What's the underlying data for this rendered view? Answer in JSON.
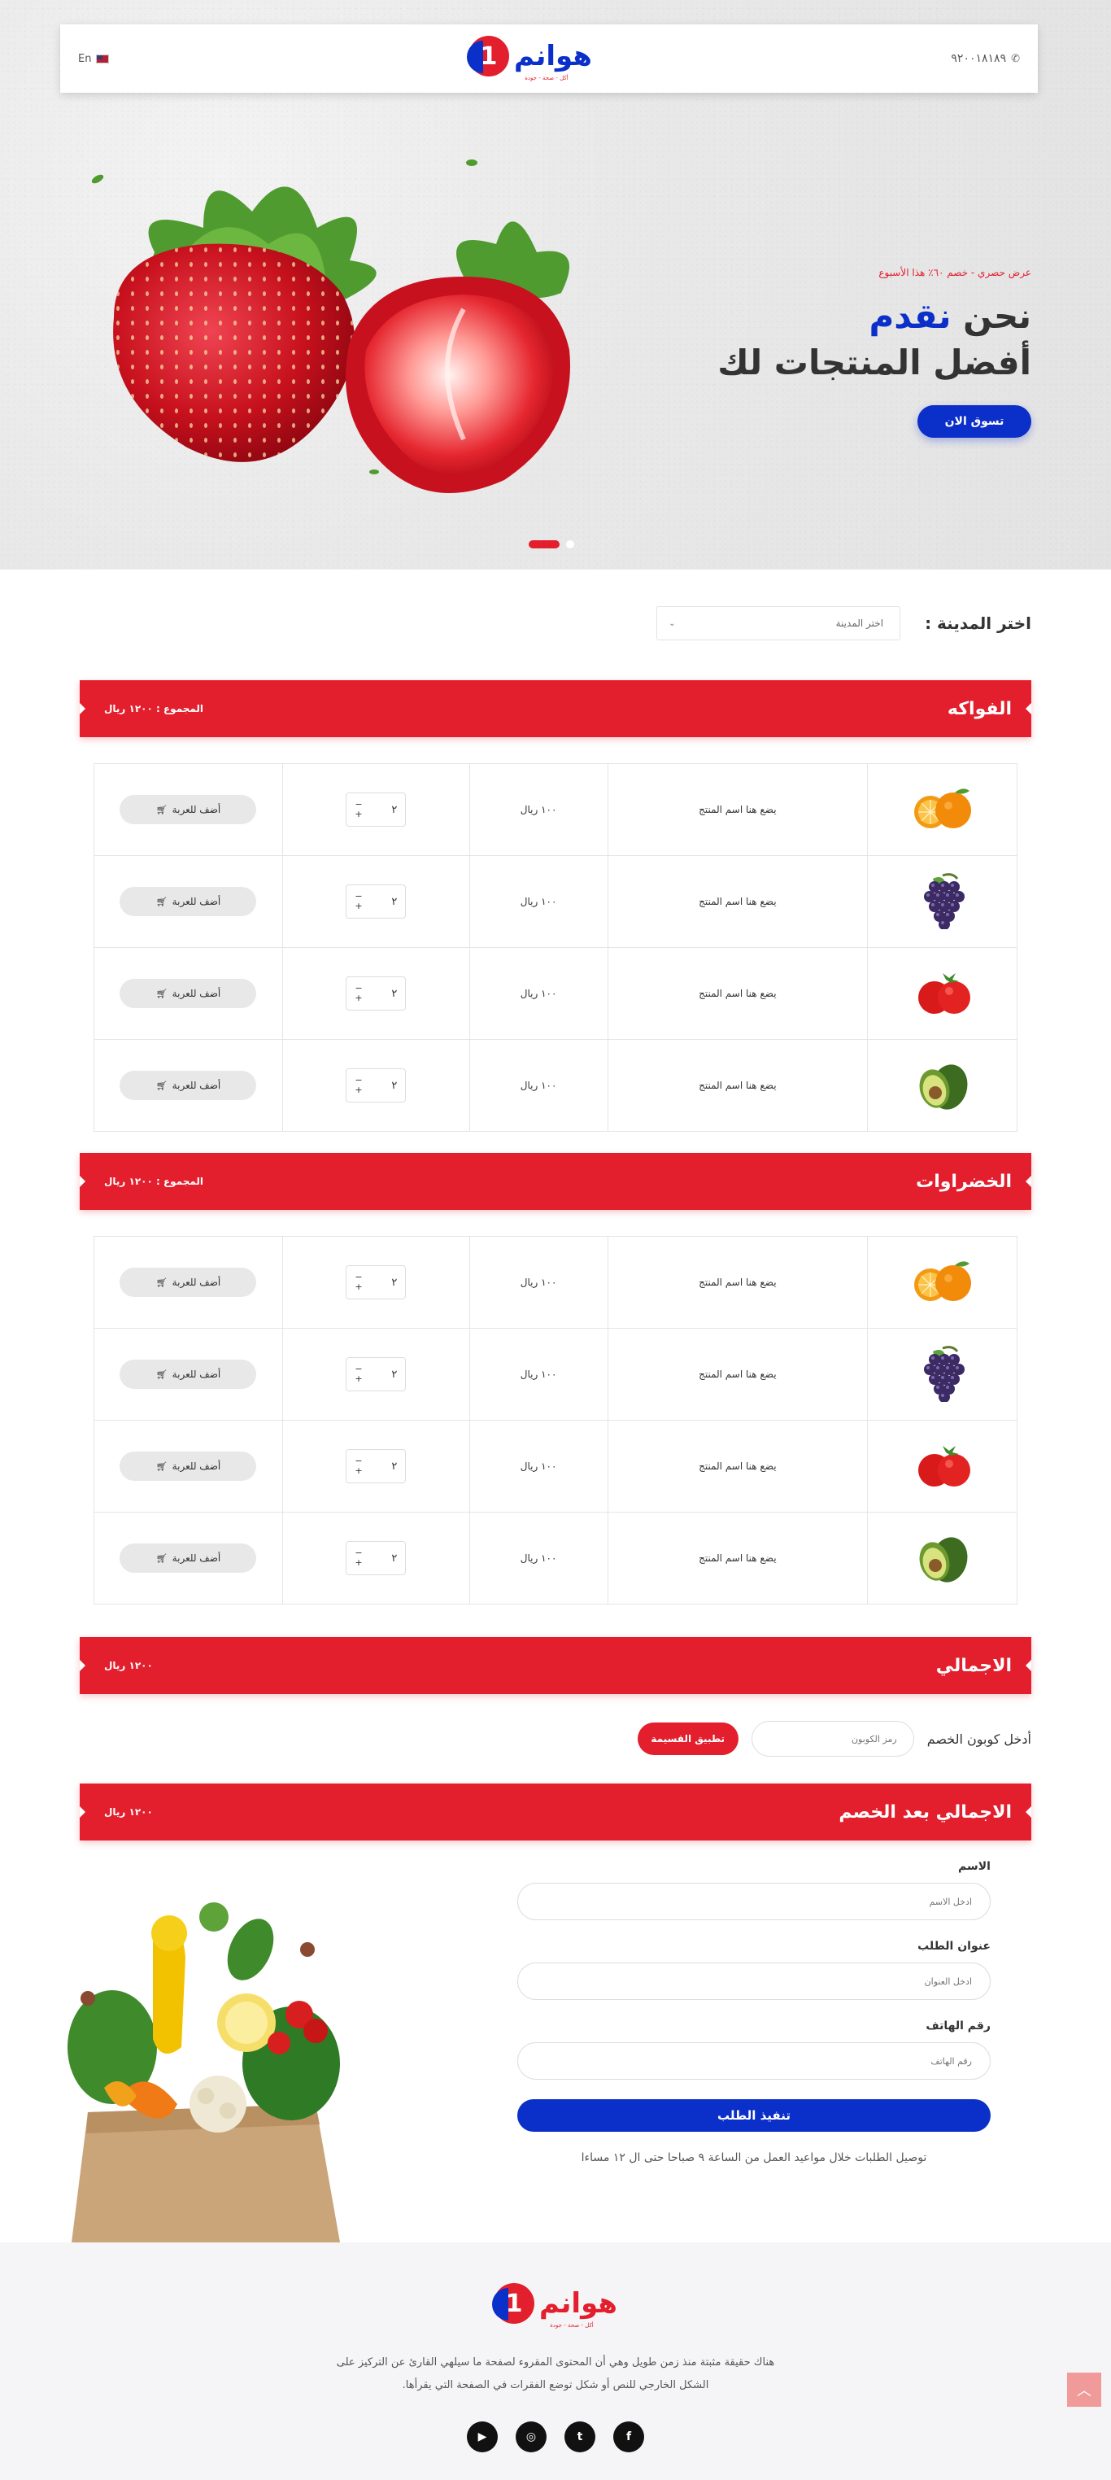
{
  "header": {
    "phone": "٩٢٠٠١٨١٨٩",
    "lang": "En",
    "logo_text": "هوانم",
    "logo_digit": "1",
    "logo_tagline": "أكل - صحة - جودة"
  },
  "hero": {
    "promo": "عرض حصري - خصم ٦٠٪ هذا الأسبوع",
    "headline_prefix": "نحن",
    "headline_accent": "نقدم",
    "headline2": "أفضل المنتجات لك",
    "cta": "تسوق الان"
  },
  "city": {
    "label": "اختر المدينة :",
    "placeholder": "اختر المدينة"
  },
  "sections": [
    {
      "title": "الفواكه",
      "sum_label": "المجموع : ١٢٠٠ ريال",
      "products": [
        {
          "fruit": "orange",
          "name": "يضع هنا اسم المنتج",
          "price": "١٠٠ ريال",
          "qty": "٢",
          "add": "أضف للعربة"
        },
        {
          "fruit": "grapes",
          "name": "يضع هنا اسم المنتج",
          "price": "١٠٠ ريال",
          "qty": "٢",
          "add": "أضف للعربة"
        },
        {
          "fruit": "tomato",
          "name": "يضع هنا اسم المنتج",
          "price": "١٠٠ ريال",
          "qty": "٢",
          "add": "أضف للعربة"
        },
        {
          "fruit": "avocado",
          "name": "يضع هنا اسم المنتج",
          "price": "١٠٠ ريال",
          "qty": "٢",
          "add": "أضف للعربة"
        }
      ]
    },
    {
      "title": "الخضراوات",
      "sum_label": "المجموع : ١٢٠٠ ريال",
      "products": [
        {
          "fruit": "orange",
          "name": "يضع هنا اسم المنتج",
          "price": "١٠٠ ريال",
          "qty": "٢",
          "add": "أضف للعربة"
        },
        {
          "fruit": "grapes",
          "name": "يضع هنا اسم المنتج",
          "price": "١٠٠ ريال",
          "qty": "٢",
          "add": "أضف للعربة"
        },
        {
          "fruit": "tomato",
          "name": "يضع هنا اسم المنتج",
          "price": "١٠٠ ريال",
          "qty": "٢",
          "add": "أضف للعربة"
        },
        {
          "fruit": "avocado",
          "name": "يضع هنا اسم المنتج",
          "price": "١٠٠ ريال",
          "qty": "٢",
          "add": "أضف للعربة"
        }
      ]
    }
  ],
  "total": {
    "title": "الاجمالي",
    "value": "١٢٠٠ ريال"
  },
  "coupon": {
    "label": "أدخل كوبون الخصم",
    "placeholder": "رمز الكوبون",
    "button": "تطبيق القسيمة"
  },
  "total_after": {
    "title": "الاجمالي بعد الخصم",
    "value": "١٢٠٠ ريال"
  },
  "form": {
    "name_label": "الاسم",
    "name_placeholder": "ادخل الاسم",
    "address_label": "عنوان الطلب",
    "address_placeholder": "ادخل العنوان",
    "phone_label": "رقم الهاتف",
    "phone_placeholder": "رقم الهاتف",
    "submit": "تنفيذ الطلب",
    "note": "توصيل الطلبات خلال مواعيد العمل من الساعة ٩ صباحا حتى ال ١٢ مساءا"
  },
  "footer": {
    "line1": "هناك حقيقة مثبتة منذ زمن طويل وهي أن المحتوى المقروء لصفحة ما سيلهي القارئ عن التركيز على",
    "line2": "الشكل الخارجي للنص أو شكل توضع الفقرات في الصفحة التي يقرأها.",
    "socials": [
      "youtube",
      "instagram",
      "twitter",
      "facebook"
    ],
    "social_glyphs": {
      "youtube": "▶",
      "instagram": "◎",
      "twitter": "t",
      "facebook": "f"
    }
  },
  "colors": {
    "brand_red": "#e31e2d",
    "brand_blue": "#0b2fc9"
  }
}
